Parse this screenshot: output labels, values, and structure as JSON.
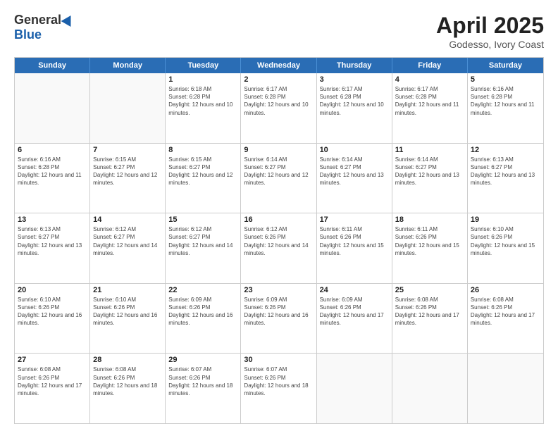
{
  "header": {
    "logo_general": "General",
    "logo_blue": "Blue",
    "title": "April 2025",
    "subtitle": "Godesso, Ivory Coast"
  },
  "weekdays": [
    "Sunday",
    "Monday",
    "Tuesday",
    "Wednesday",
    "Thursday",
    "Friday",
    "Saturday"
  ],
  "rows": [
    [
      {
        "day": "",
        "info": ""
      },
      {
        "day": "",
        "info": ""
      },
      {
        "day": "1",
        "info": "Sunrise: 6:18 AM\nSunset: 6:28 PM\nDaylight: 12 hours and 10 minutes."
      },
      {
        "day": "2",
        "info": "Sunrise: 6:17 AM\nSunset: 6:28 PM\nDaylight: 12 hours and 10 minutes."
      },
      {
        "day": "3",
        "info": "Sunrise: 6:17 AM\nSunset: 6:28 PM\nDaylight: 12 hours and 10 minutes."
      },
      {
        "day": "4",
        "info": "Sunrise: 6:17 AM\nSunset: 6:28 PM\nDaylight: 12 hours and 11 minutes."
      },
      {
        "day": "5",
        "info": "Sunrise: 6:16 AM\nSunset: 6:28 PM\nDaylight: 12 hours and 11 minutes."
      }
    ],
    [
      {
        "day": "6",
        "info": "Sunrise: 6:16 AM\nSunset: 6:28 PM\nDaylight: 12 hours and 11 minutes."
      },
      {
        "day": "7",
        "info": "Sunrise: 6:15 AM\nSunset: 6:27 PM\nDaylight: 12 hours and 12 minutes."
      },
      {
        "day": "8",
        "info": "Sunrise: 6:15 AM\nSunset: 6:27 PM\nDaylight: 12 hours and 12 minutes."
      },
      {
        "day": "9",
        "info": "Sunrise: 6:14 AM\nSunset: 6:27 PM\nDaylight: 12 hours and 12 minutes."
      },
      {
        "day": "10",
        "info": "Sunrise: 6:14 AM\nSunset: 6:27 PM\nDaylight: 12 hours and 13 minutes."
      },
      {
        "day": "11",
        "info": "Sunrise: 6:14 AM\nSunset: 6:27 PM\nDaylight: 12 hours and 13 minutes."
      },
      {
        "day": "12",
        "info": "Sunrise: 6:13 AM\nSunset: 6:27 PM\nDaylight: 12 hours and 13 minutes."
      }
    ],
    [
      {
        "day": "13",
        "info": "Sunrise: 6:13 AM\nSunset: 6:27 PM\nDaylight: 12 hours and 13 minutes."
      },
      {
        "day": "14",
        "info": "Sunrise: 6:12 AM\nSunset: 6:27 PM\nDaylight: 12 hours and 14 minutes."
      },
      {
        "day": "15",
        "info": "Sunrise: 6:12 AM\nSunset: 6:27 PM\nDaylight: 12 hours and 14 minutes."
      },
      {
        "day": "16",
        "info": "Sunrise: 6:12 AM\nSunset: 6:26 PM\nDaylight: 12 hours and 14 minutes."
      },
      {
        "day": "17",
        "info": "Sunrise: 6:11 AM\nSunset: 6:26 PM\nDaylight: 12 hours and 15 minutes."
      },
      {
        "day": "18",
        "info": "Sunrise: 6:11 AM\nSunset: 6:26 PM\nDaylight: 12 hours and 15 minutes."
      },
      {
        "day": "19",
        "info": "Sunrise: 6:10 AM\nSunset: 6:26 PM\nDaylight: 12 hours and 15 minutes."
      }
    ],
    [
      {
        "day": "20",
        "info": "Sunrise: 6:10 AM\nSunset: 6:26 PM\nDaylight: 12 hours and 16 minutes."
      },
      {
        "day": "21",
        "info": "Sunrise: 6:10 AM\nSunset: 6:26 PM\nDaylight: 12 hours and 16 minutes."
      },
      {
        "day": "22",
        "info": "Sunrise: 6:09 AM\nSunset: 6:26 PM\nDaylight: 12 hours and 16 minutes."
      },
      {
        "day": "23",
        "info": "Sunrise: 6:09 AM\nSunset: 6:26 PM\nDaylight: 12 hours and 16 minutes."
      },
      {
        "day": "24",
        "info": "Sunrise: 6:09 AM\nSunset: 6:26 PM\nDaylight: 12 hours and 17 minutes."
      },
      {
        "day": "25",
        "info": "Sunrise: 6:08 AM\nSunset: 6:26 PM\nDaylight: 12 hours and 17 minutes."
      },
      {
        "day": "26",
        "info": "Sunrise: 6:08 AM\nSunset: 6:26 PM\nDaylight: 12 hours and 17 minutes."
      }
    ],
    [
      {
        "day": "27",
        "info": "Sunrise: 6:08 AM\nSunset: 6:26 PM\nDaylight: 12 hours and 17 minutes."
      },
      {
        "day": "28",
        "info": "Sunrise: 6:08 AM\nSunset: 6:26 PM\nDaylight: 12 hours and 18 minutes."
      },
      {
        "day": "29",
        "info": "Sunrise: 6:07 AM\nSunset: 6:26 PM\nDaylight: 12 hours and 18 minutes."
      },
      {
        "day": "30",
        "info": "Sunrise: 6:07 AM\nSunset: 6:26 PM\nDaylight: 12 hours and 18 minutes."
      },
      {
        "day": "",
        "info": ""
      },
      {
        "day": "",
        "info": ""
      },
      {
        "day": "",
        "info": ""
      }
    ]
  ]
}
